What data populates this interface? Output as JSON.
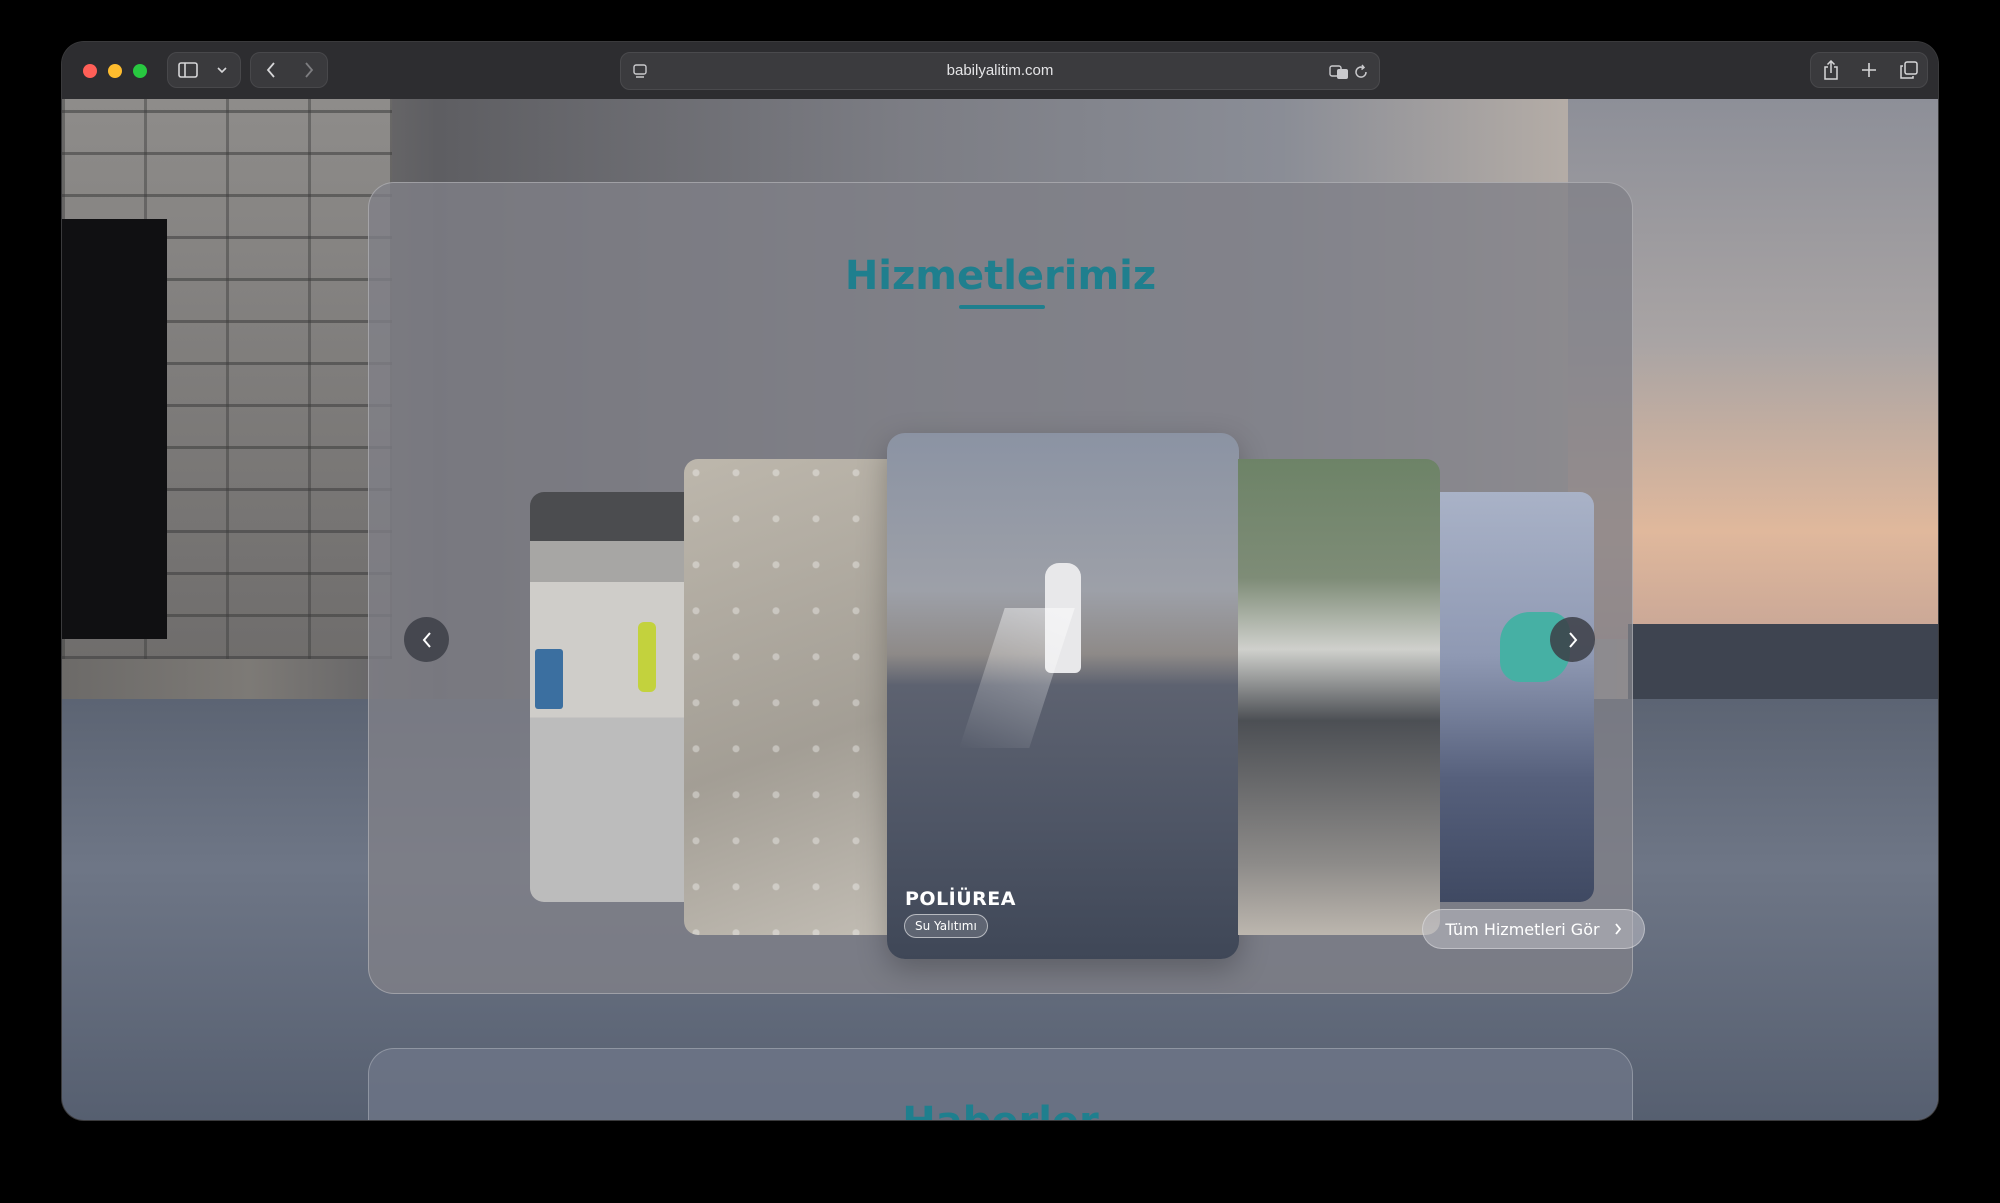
{
  "browser": {
    "url": "babilyalitim.com"
  },
  "services": {
    "heading": "Hizmetlerimiz",
    "active_slide": {
      "title": "POLİÜREA",
      "tag": "Su Yalıtımı"
    },
    "cta_label": "Tüm Hizmetleri Gör"
  },
  "news": {
    "heading": "Haberler"
  },
  "colors": {
    "accent": "#1f7f8e",
    "traffic_close": "#ff5f57",
    "traffic_minimize": "#febc2e",
    "traffic_zoom": "#28c840"
  }
}
